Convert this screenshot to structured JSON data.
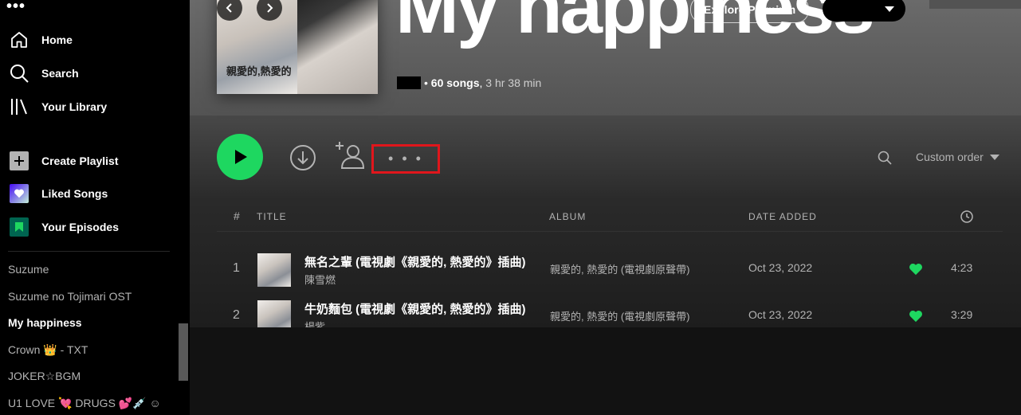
{
  "sidebar": {
    "nav": [
      {
        "label": "Home",
        "icon": "home-icon"
      },
      {
        "label": "Search",
        "icon": "search-icon"
      },
      {
        "label": "Your Library",
        "icon": "library-icon"
      }
    ],
    "actions": [
      {
        "label": "Create Playlist",
        "icon": "plus-icon"
      },
      {
        "label": "Liked Songs",
        "icon": "heart-icon"
      },
      {
        "label": "Your Episodes",
        "icon": "bookmark-icon"
      }
    ],
    "playlists": [
      {
        "label": "Suzume"
      },
      {
        "label": "Suzume no Tojimari OST"
      },
      {
        "label": "My happiness",
        "current": true
      },
      {
        "label": "Crown 👑 - TXT"
      },
      {
        "label": "JOKER☆BGM"
      },
      {
        "label": "U1 LOVE 💘 DRUGS 💕💉 ☺"
      }
    ]
  },
  "header": {
    "title": "My happiness",
    "explore_label": "Explore Premium",
    "cover_text": "親愛的,熱愛的",
    "meta": {
      "songs": "60 songs",
      "duration": "3 hr 38 min"
    }
  },
  "actions": {
    "more_label": "• • •",
    "sort_label": "Custom order"
  },
  "table": {
    "headers": {
      "num": "#",
      "title": "TITLE",
      "album": "ALBUM",
      "date": "DATE ADDED"
    },
    "rows": [
      {
        "num": "1",
        "title": "無名之輩 (電視劇《親愛的, 熱愛的》插曲)",
        "artist": "陳雪燃",
        "album": "親愛的, 熱愛的 (電視劇原聲帶)",
        "date": "Oct 23, 2022",
        "duration": "4:23"
      },
      {
        "num": "2",
        "title": "牛奶麵包 (電視劇《親愛的, 熱愛的》插曲)",
        "artist": "楊紫",
        "album": "親愛的, 熱愛的 (電視劇原聲帶)",
        "date": "Oct 23, 2022",
        "duration": "3:29"
      }
    ]
  },
  "colors": {
    "accent": "#1ed760",
    "highlight": "#e0161c"
  }
}
